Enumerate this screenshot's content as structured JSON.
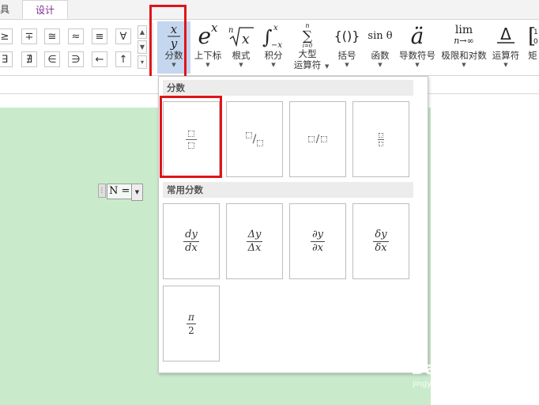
{
  "tabs": {
    "left_partial": "具",
    "design": "设计"
  },
  "symbols_row1": [
    "≥",
    "∓",
    "≅",
    "≈",
    "≡",
    "∀"
  ],
  "symbols_row2": [
    "∃",
    "∄",
    "∈",
    "∋",
    "←",
    "↑"
  ],
  "tools": {
    "fraction": "分数",
    "script": "上下标",
    "radical": "根式",
    "integral": "积分",
    "large_op_1": "大型",
    "large_op_2": "运算符",
    "bracket": "括号",
    "function": "函数",
    "accent": "导数符号",
    "limit_log": "极限和对数",
    "operator": "运算符",
    "matrix_partial": "矩"
  },
  "tool_glyphs": {
    "function": "sin θ",
    "limit_top": "lim",
    "limit_bottom": "n→∞",
    "bracket": "{()}",
    "accent": "ä"
  },
  "equation": {
    "text": "N ="
  },
  "dropdown": {
    "section1": "分数",
    "section2": "常用分数",
    "common": [
      {
        "num": "dy",
        "den": "dx"
      },
      {
        "num": "Δy",
        "den": "Δx"
      },
      {
        "num": "∂y",
        "den": "∂x"
      },
      {
        "num": "δy",
        "den": "δx"
      },
      {
        "num": "π",
        "den": "2"
      }
    ]
  },
  "watermark": {
    "brand": "Bai 经验",
    "url": "jingyan.baidu.com"
  },
  "colors": {
    "accent_purple": "#7a2b8f",
    "highlight_red": "#e0141a",
    "doc_green": "#c9ebcc",
    "selected_tool": "#c5d7ee"
  }
}
